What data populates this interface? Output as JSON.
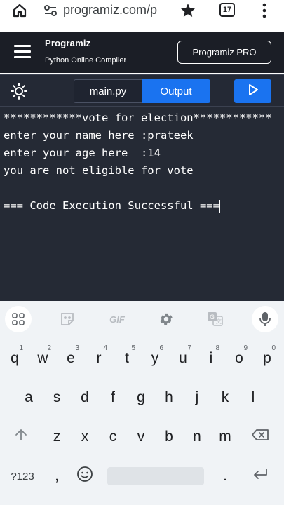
{
  "browser": {
    "url": "programiz.com/p",
    "tab_count": "17"
  },
  "header": {
    "logo": "Programiz",
    "subtitle": "Python Online Compiler",
    "pro_button": "Programiz PRO"
  },
  "toolbar": {
    "file_tab": "main.py",
    "output_tab": "Output"
  },
  "console": {
    "lines": [
      "************vote for election************",
      "enter your name here :prateek",
      "enter your age here  :14",
      "you are not eligible for vote",
      "",
      "=== Code Execution Successful ==="
    ]
  },
  "keyboard": {
    "gif_label": "GIF",
    "row1": [
      "q",
      "w",
      "e",
      "r",
      "t",
      "y",
      "u",
      "i",
      "o",
      "p"
    ],
    "row1_hints": [
      "1",
      "2",
      "3",
      "4",
      "5",
      "6",
      "7",
      "8",
      "9",
      "0"
    ],
    "row2": [
      "a",
      "s",
      "d",
      "f",
      "g",
      "h",
      "j",
      "k",
      "l"
    ],
    "row3": [
      "z",
      "x",
      "c",
      "v",
      "b",
      "n",
      "m"
    ],
    "symbols_key": "?123",
    "comma_key": ",",
    "period_key": "."
  },
  "colors": {
    "accent": "#1a73f0",
    "header_bg": "#1b1e26",
    "console_bg": "#252a35"
  }
}
